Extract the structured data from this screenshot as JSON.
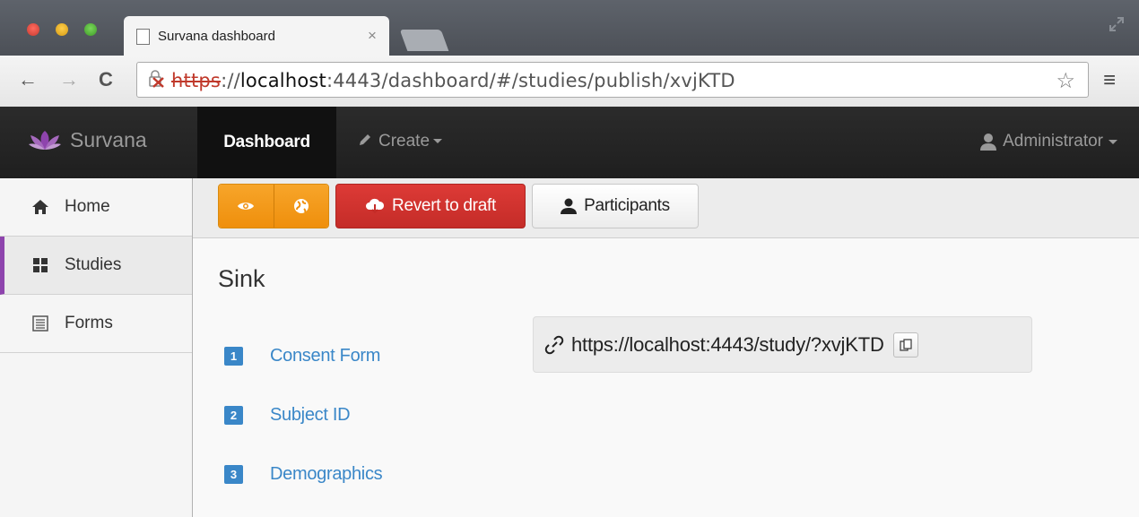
{
  "browser": {
    "tab_title": "Survana dashboard",
    "tab_close": "×",
    "url_protocol": "https",
    "url_host": "localhost",
    "url_rest": ":4443/dashboard/#/studies/publish/xvjKTD",
    "url_separator": "://",
    "nav_back": "←",
    "nav_forward": "→",
    "nav_reload": "C",
    "bookmark_glyph": "☆",
    "menu_glyph": "≡"
  },
  "navbar": {
    "brand": "Survana",
    "dashboard": "Dashboard",
    "create": "Create",
    "user": "Administrator"
  },
  "sidebar": {
    "items": [
      {
        "label": "Home",
        "icon": "home-icon"
      },
      {
        "label": "Studies",
        "icon": "grid-icon",
        "active": true
      },
      {
        "label": "Forms",
        "icon": "list-icon"
      }
    ]
  },
  "toolbar": {
    "revert_label": "Revert to draft",
    "participants_label": "Participants"
  },
  "study": {
    "title": "Sink",
    "steps": [
      {
        "num": "1",
        "label": "Consent Form"
      },
      {
        "num": "2",
        "label": "Subject ID"
      },
      {
        "num": "3",
        "label": "Demographics"
      }
    ],
    "public_url": "https://localhost:4443/study/?xvjKTD"
  },
  "colors": {
    "accent_purple": "#8e44ad",
    "link_blue": "#3a87c8",
    "orange": "#f29b1b",
    "danger_red": "#d0332f"
  }
}
